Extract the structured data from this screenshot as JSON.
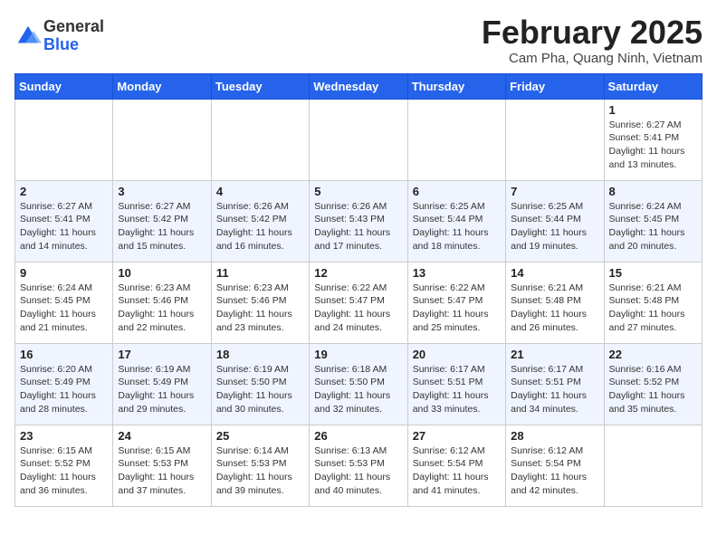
{
  "logo": {
    "general": "General",
    "blue": "Blue"
  },
  "header": {
    "title": "February 2025",
    "subtitle": "Cam Pha, Quang Ninh, Vietnam"
  },
  "days_of_week": [
    "Sunday",
    "Monday",
    "Tuesday",
    "Wednesday",
    "Thursday",
    "Friday",
    "Saturday"
  ],
  "weeks": [
    [
      {
        "day": "",
        "info": ""
      },
      {
        "day": "",
        "info": ""
      },
      {
        "day": "",
        "info": ""
      },
      {
        "day": "",
        "info": ""
      },
      {
        "day": "",
        "info": ""
      },
      {
        "day": "",
        "info": ""
      },
      {
        "day": "1",
        "info": "Sunrise: 6:27 AM\nSunset: 5:41 PM\nDaylight: 11 hours and 13 minutes."
      }
    ],
    [
      {
        "day": "2",
        "info": "Sunrise: 6:27 AM\nSunset: 5:41 PM\nDaylight: 11 hours and 14 minutes."
      },
      {
        "day": "3",
        "info": "Sunrise: 6:27 AM\nSunset: 5:42 PM\nDaylight: 11 hours and 15 minutes."
      },
      {
        "day": "4",
        "info": "Sunrise: 6:26 AM\nSunset: 5:42 PM\nDaylight: 11 hours and 16 minutes."
      },
      {
        "day": "5",
        "info": "Sunrise: 6:26 AM\nSunset: 5:43 PM\nDaylight: 11 hours and 17 minutes."
      },
      {
        "day": "6",
        "info": "Sunrise: 6:25 AM\nSunset: 5:44 PM\nDaylight: 11 hours and 18 minutes."
      },
      {
        "day": "7",
        "info": "Sunrise: 6:25 AM\nSunset: 5:44 PM\nDaylight: 11 hours and 19 minutes."
      },
      {
        "day": "8",
        "info": "Sunrise: 6:24 AM\nSunset: 5:45 PM\nDaylight: 11 hours and 20 minutes."
      }
    ],
    [
      {
        "day": "9",
        "info": "Sunrise: 6:24 AM\nSunset: 5:45 PM\nDaylight: 11 hours and 21 minutes."
      },
      {
        "day": "10",
        "info": "Sunrise: 6:23 AM\nSunset: 5:46 PM\nDaylight: 11 hours and 22 minutes."
      },
      {
        "day": "11",
        "info": "Sunrise: 6:23 AM\nSunset: 5:46 PM\nDaylight: 11 hours and 23 minutes."
      },
      {
        "day": "12",
        "info": "Sunrise: 6:22 AM\nSunset: 5:47 PM\nDaylight: 11 hours and 24 minutes."
      },
      {
        "day": "13",
        "info": "Sunrise: 6:22 AM\nSunset: 5:47 PM\nDaylight: 11 hours and 25 minutes."
      },
      {
        "day": "14",
        "info": "Sunrise: 6:21 AM\nSunset: 5:48 PM\nDaylight: 11 hours and 26 minutes."
      },
      {
        "day": "15",
        "info": "Sunrise: 6:21 AM\nSunset: 5:48 PM\nDaylight: 11 hours and 27 minutes."
      }
    ],
    [
      {
        "day": "16",
        "info": "Sunrise: 6:20 AM\nSunset: 5:49 PM\nDaylight: 11 hours and 28 minutes."
      },
      {
        "day": "17",
        "info": "Sunrise: 6:19 AM\nSunset: 5:49 PM\nDaylight: 11 hours and 29 minutes."
      },
      {
        "day": "18",
        "info": "Sunrise: 6:19 AM\nSunset: 5:50 PM\nDaylight: 11 hours and 30 minutes."
      },
      {
        "day": "19",
        "info": "Sunrise: 6:18 AM\nSunset: 5:50 PM\nDaylight: 11 hours and 32 minutes."
      },
      {
        "day": "20",
        "info": "Sunrise: 6:17 AM\nSunset: 5:51 PM\nDaylight: 11 hours and 33 minutes."
      },
      {
        "day": "21",
        "info": "Sunrise: 6:17 AM\nSunset: 5:51 PM\nDaylight: 11 hours and 34 minutes."
      },
      {
        "day": "22",
        "info": "Sunrise: 6:16 AM\nSunset: 5:52 PM\nDaylight: 11 hours and 35 minutes."
      }
    ],
    [
      {
        "day": "23",
        "info": "Sunrise: 6:15 AM\nSunset: 5:52 PM\nDaylight: 11 hours and 36 minutes."
      },
      {
        "day": "24",
        "info": "Sunrise: 6:15 AM\nSunset: 5:53 PM\nDaylight: 11 hours and 37 minutes."
      },
      {
        "day": "25",
        "info": "Sunrise: 6:14 AM\nSunset: 5:53 PM\nDaylight: 11 hours and 39 minutes."
      },
      {
        "day": "26",
        "info": "Sunrise: 6:13 AM\nSunset: 5:53 PM\nDaylight: 11 hours and 40 minutes."
      },
      {
        "day": "27",
        "info": "Sunrise: 6:12 AM\nSunset: 5:54 PM\nDaylight: 11 hours and 41 minutes."
      },
      {
        "day": "28",
        "info": "Sunrise: 6:12 AM\nSunset: 5:54 PM\nDaylight: 11 hours and 42 minutes."
      },
      {
        "day": "",
        "info": ""
      }
    ]
  ]
}
